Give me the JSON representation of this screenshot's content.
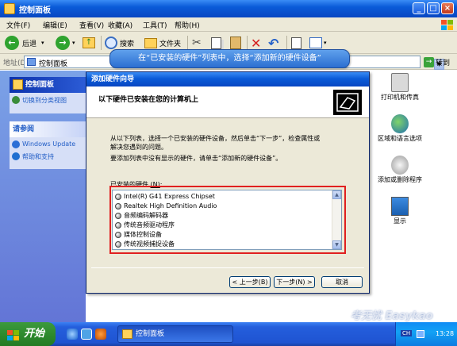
{
  "window": {
    "title": "控制面板"
  },
  "menu": [
    "文件(F)",
    "编辑(E)",
    "查看(V)",
    "收藏(A)",
    "工具(T)",
    "帮助(H)"
  ],
  "toolbar": {
    "back_label": "后退",
    "search_label": "搜索",
    "folders_label": "文件夹"
  },
  "address": {
    "label": "地址(D)",
    "value": "控制面板",
    "go_label": "转到"
  },
  "callout": {
    "text": "在“已安装的硬件”列表中，选择“添加新的硬件设备”"
  },
  "pane": {
    "header": "控制面板",
    "switch_link": "切换到分类视图",
    "see_also_header": "请参阅",
    "see_also": [
      "Windows Update",
      "帮助和支持"
    ]
  },
  "right_icons": [
    "打印机和传真",
    "区域和语言选项",
    "添加或删除程序",
    "显示"
  ],
  "dialog": {
    "title": "添加硬件向导",
    "heading": "以下硬件已安装在您的计算机上",
    "para1_line1": "从以下列表，选择一个已安装的硬件设备，然后单击“下一步”，检查属性或",
    "para1_line2": "解决您遇到的问题。",
    "para2": "要添加列表中没有显示的硬件，请单击“添加新的硬件设备”。",
    "list_label": "已安装的硬件",
    "list_label_key": "(N)",
    "items": [
      "Intel(R) G41 Express Chipset",
      "Realtek High Definition Audio",
      "音频编码解码器",
      "传统音频驱动程序",
      "媒体控制设备",
      "传统视频捕捉设备"
    ],
    "back_button": "< 上一步(B)",
    "next_button": "下一步(N) >",
    "cancel_button": "取消"
  },
  "taskbar": {
    "start_label": "开始",
    "task": "控制面板",
    "lang": "CH",
    "time": "13:28"
  },
  "watermark": "考无忧 Easykao"
}
